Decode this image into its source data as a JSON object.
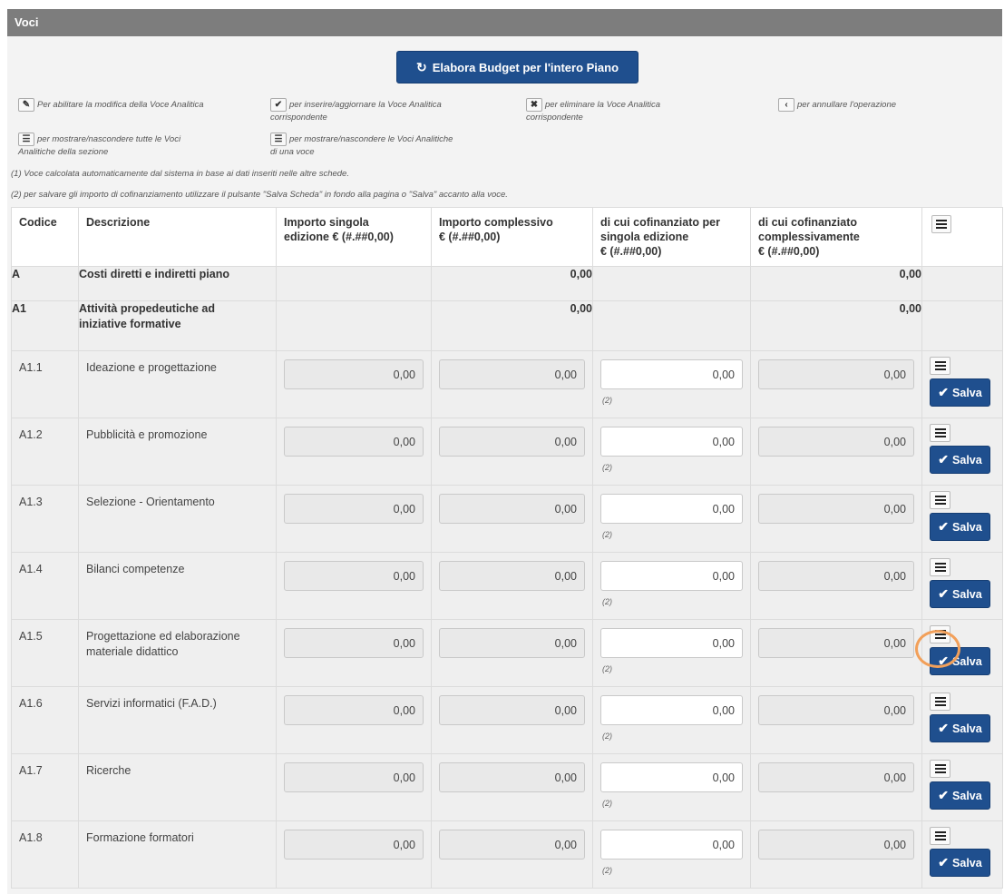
{
  "panel": {
    "title": "Voci"
  },
  "toolbar": {
    "elabora_label": "Elabora Budget per l'intero Piano",
    "elabora_icon": "refresh-icon"
  },
  "legend": {
    "edit": {
      "icon": "edit-icon",
      "text_a": "Per abilitare la modifica della Voce Analitica"
    },
    "insert": {
      "icon": "check-icon",
      "text_a": "per inserire/aggiornare la Voce Analitica",
      "text_b": "corrispondente"
    },
    "delete": {
      "icon": "close-icon",
      "text_a": "per eliminare la Voce Analitica",
      "text_b": "corrispondente"
    },
    "cancel": {
      "icon": "chevron-left-icon",
      "text_a": "per annullare l'operazione"
    },
    "toggle_all": {
      "icon": "list-icon",
      "text_a": "per mostrare/nascondere tutte le Voci",
      "text_b": "Analitiche della sezione"
    },
    "toggle_one": {
      "icon": "list-icon",
      "text_a": "per mostrare/nascondere le Voci Analitiche",
      "text_b": "di una voce"
    }
  },
  "notes": {
    "n1": "(1) Voce calcolata automaticamente dal sistema in base ai dati inseriti nelle altre schede.",
    "n2": "(2) per salvare gli importo di cofinanziamento utilizzare il pulsante \"Salva Scheda\" in fondo alla pagina o \"Salva\" accanto alla voce."
  },
  "table": {
    "headers": {
      "codice": "Codice",
      "descrizione": "Descrizione",
      "singola_1": "Importo singola",
      "singola_2": "edizione € (#.##0,00)",
      "compl_1": "Importo complessivo",
      "compl_2": "€ (#.##0,00)",
      "cof_sing_1": "di cui cofinanziato per",
      "cof_sing_2": "singola edizione",
      "cof_sing_3": "€ (#.##0,00)",
      "cof_compl_1": "di cui cofinanziato",
      "cof_compl_2": "complessivamente",
      "cof_compl_3": "€ (#.##0,00)"
    },
    "sections": [
      {
        "code": "A",
        "desc": "Costi diretti e indiretti piano",
        "compl": "0,00",
        "cof_compl": "0,00"
      },
      {
        "code": "A1",
        "desc_a": "Attività propedeutiche ad",
        "desc_b": "iniziative formative",
        "compl": "0,00",
        "cof_compl": "0,00"
      }
    ],
    "note_marker": "(2)",
    "save_label": "Salva",
    "rows": [
      {
        "code": "A1.1",
        "desc_a": "Ideazione e progettazione",
        "desc_b": "",
        "singola": "0,00",
        "compl": "0,00",
        "cof_sing": "0,00",
        "cof_compl": "0,00"
      },
      {
        "code": "A1.2",
        "desc_a": "Pubblicità e promozione",
        "desc_b": "",
        "singola": "0,00",
        "compl": "0,00",
        "cof_sing": "0,00",
        "cof_compl": "0,00"
      },
      {
        "code": "A1.3",
        "desc_a": "Selezione - Orientamento",
        "desc_b": "",
        "singola": "0,00",
        "compl": "0,00",
        "cof_sing": "0,00",
        "cof_compl": "0,00"
      },
      {
        "code": "A1.4",
        "desc_a": "Bilanci competenze",
        "desc_b": "",
        "singola": "0,00",
        "compl": "0,00",
        "cof_sing": "0,00",
        "cof_compl": "0,00"
      },
      {
        "code": "A1.5",
        "desc_a": "Progettazione ed elaborazione",
        "desc_b": "materiale didattico",
        "singola": "0,00",
        "compl": "0,00",
        "cof_sing": "0,00",
        "cof_compl": "0,00"
      },
      {
        "code": "A1.6",
        "desc_a": "Servizi informatici (F.A.D.)",
        "desc_b": "",
        "singola": "0,00",
        "compl": "0,00",
        "cof_sing": "0,00",
        "cof_compl": "0,00"
      },
      {
        "code": "A1.7",
        "desc_a": "Ricerche",
        "desc_b": "",
        "singola": "0,00",
        "compl": "0,00",
        "cof_sing": "0,00",
        "cof_compl": "0,00"
      },
      {
        "code": "A1.8",
        "desc_a": "Formazione formatori",
        "desc_b": "",
        "singola": "0,00",
        "compl": "0,00",
        "cof_sing": "0,00",
        "cof_compl": "0,00"
      }
    ]
  },
  "colors": {
    "header_bar": "#7d7d7d",
    "primary_button": "#1f4f8e",
    "highlight_ring": "#f2a05a"
  }
}
